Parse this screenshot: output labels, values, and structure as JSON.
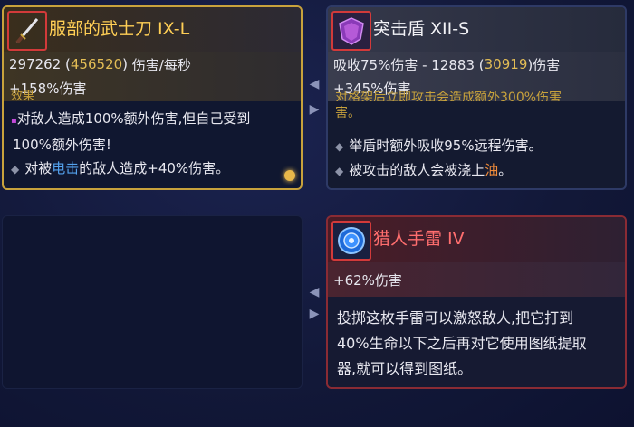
{
  "weapon": {
    "title": "服部的武士刀 IX-L",
    "dps": "297262",
    "dps_max": "456520",
    "dps_unit": "伤害/每秒",
    "bonus": "+158%伤害",
    "clipped_text": "效果",
    "line1": "对敌人造成100%额外伤害,但自己受到",
    "line2": "100%额外伤害!",
    "line3_pre": "对被",
    "line3_hl": "电击",
    "line3_post": "的敌人造成+40%伤害。",
    "icon": "katana-icon"
  },
  "shield": {
    "title": "突击盾 XII-S",
    "stat_pre": "吸收75%伤害 - 12883 (",
    "stat_max": "30919",
    "stat_post": ")伤害",
    "bonus": "+345%伤害",
    "clipped_text": "对格架后立即攻击会造成额外300%伤害",
    "clipped_line2": "害。",
    "line1": "举盾时额外吸收95%远程伤害。",
    "line2_pre": "被攻击的敌人会被浇上",
    "line2_hl": "油",
    "line2_post": "。",
    "icon": "shield-icon"
  },
  "grenade": {
    "title": "猎人手雷 IV",
    "bonus": "+62%伤害",
    "desc1": "投掷这枚手雷可以激怒敌人,把它打到",
    "desc2": "40%生命以下之后再对它使用图纸提取",
    "desc3": "器,就可以得到图纸。",
    "icon": "grenade-icon"
  },
  "colors": {
    "gold": "#e3bd55",
    "highlight_blue": "#54a2ee",
    "highlight_orange": "#ee8a3a",
    "title_red": "#ff6e6e"
  }
}
